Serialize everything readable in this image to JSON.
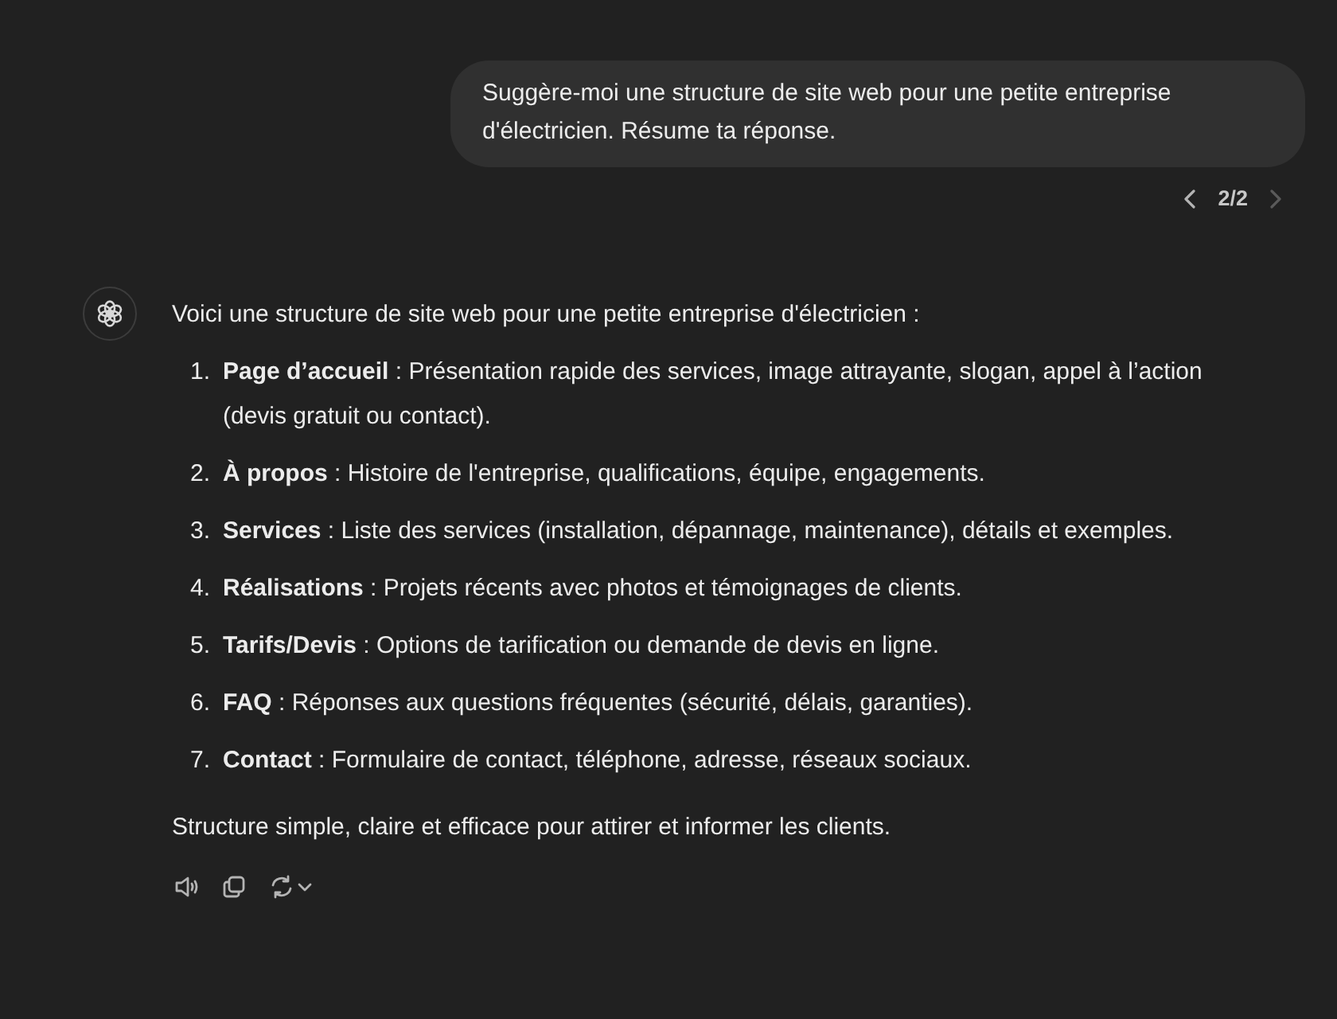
{
  "user_message": {
    "text": "Suggère-moi une structure de site web pour une petite entreprise d'électricien. Résume ta réponse."
  },
  "pager": {
    "label": "2/2",
    "prev_disabled": false,
    "next_disabled": true
  },
  "assistant_message": {
    "intro": "Voici une structure de site web pour une petite entreprise d'électricien :",
    "items": [
      {
        "number": "1.",
        "text": "**Page d’accueil** : Présentation rapide des services, image attrayante, slogan, appel à l’action (devis gratuit ou contact)."
      },
      {
        "number": "2.",
        "text": "**À propos** : Histoire de l'entreprise, qualifications, équipe, engagements."
      },
      {
        "number": "3.",
        "text": "**Services** : Liste des services (installation, dépannage, maintenance), détails et exemples."
      },
      {
        "number": "4.",
        "text": "**Réalisations** : Projets récents avec photos et témoignages de clients."
      },
      {
        "number": "5.",
        "text": "**Tarifs/Devis** : Options de tarification ou demande de devis en ligne."
      },
      {
        "number": "6.",
        "text": "**FAQ** : Réponses aux questions fréquentes (sécurité, délais, garanties)."
      },
      {
        "number": "7.",
        "text": "**Contact** : Formulaire de contact, téléphone, adresse, réseaux sociaux."
      }
    ],
    "outro": "Structure simple, claire et efficace pour attirer et informer les clients."
  }
}
